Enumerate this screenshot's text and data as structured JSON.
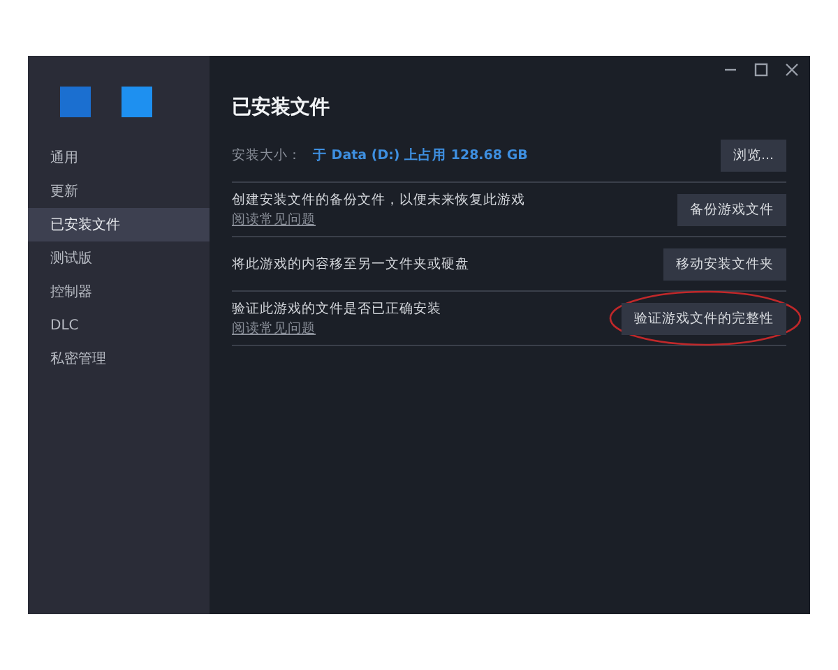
{
  "sidebar": {
    "items": [
      {
        "label": "通用",
        "selected": false
      },
      {
        "label": "更新",
        "selected": false
      },
      {
        "label": "已安装文件",
        "selected": true
      },
      {
        "label": "测试版",
        "selected": false
      },
      {
        "label": "控制器",
        "selected": false
      },
      {
        "label": "DLC",
        "selected": false
      },
      {
        "label": "私密管理",
        "selected": false
      }
    ]
  },
  "page": {
    "title": "已安装文件",
    "size": {
      "label": "安装大小：",
      "value": "于 Data (D:) 上占用 128.68 GB",
      "button": "浏览..."
    },
    "rows": [
      {
        "text": "创建安装文件的备份文件，以便未来恢复此游戏",
        "link": "阅读常见问题",
        "button": "备份游戏文件",
        "circled": false
      },
      {
        "text": "将此游戏的内容移至另一文件夹或硬盘",
        "button": "移动安装文件夹",
        "circled": false
      },
      {
        "text": "验证此游戏的文件是否已正确安装",
        "link": "阅读常见问题",
        "button": "验证游戏文件的完整性",
        "circled": true
      }
    ]
  }
}
